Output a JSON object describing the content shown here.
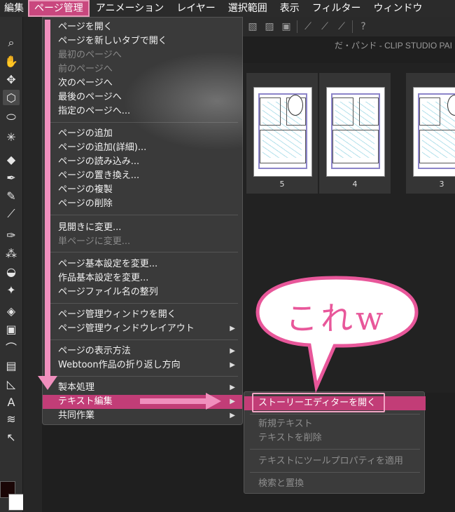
{
  "menubar": {
    "items": [
      "編集",
      "ページ管理",
      "アニメーション",
      "レイヤー",
      "選択範囲",
      "表示",
      "フィルター",
      "ウィンドウ"
    ],
    "active": "ページ管理",
    "accent": "#c9477e"
  },
  "window": {
    "title": "だ・パンド - CLIP STUDIO PAI"
  },
  "pages": [
    {
      "number": "5"
    },
    {
      "number": "4"
    },
    {
      "number": "3"
    }
  ],
  "menu": {
    "items": [
      {
        "label": "ページを開く",
        "enabled": true
      },
      {
        "label": "ページを新しいタブで開く",
        "enabled": true
      },
      {
        "label": "最初のページへ",
        "enabled": false
      },
      {
        "label": "前のページへ",
        "enabled": false
      },
      {
        "label": "次のページへ",
        "enabled": true
      },
      {
        "label": "最後のページへ",
        "enabled": true
      },
      {
        "label": "指定のページへ...",
        "enabled": true
      },
      {
        "label": "ページの追加",
        "enabled": true
      },
      {
        "label": "ページの追加(詳細)...",
        "enabled": true
      },
      {
        "label": "ページの読み込み...",
        "enabled": true
      },
      {
        "label": "ページの置き換え...",
        "enabled": true
      },
      {
        "label": "ページの複製",
        "enabled": true
      },
      {
        "label": "ページの削除",
        "enabled": true
      },
      {
        "label": "見開きに変更...",
        "enabled": true
      },
      {
        "label": "単ページに変更...",
        "enabled": false
      },
      {
        "label": "ページ基本設定を変更...",
        "enabled": true
      },
      {
        "label": "作品基本設定を変更...",
        "enabled": true
      },
      {
        "label": "ページファイル名の整列",
        "enabled": true
      },
      {
        "label": "ページ管理ウィンドウを開く",
        "enabled": true
      },
      {
        "label": "ページ管理ウィンドウレイアウト",
        "enabled": true,
        "submenu": true
      },
      {
        "label": "ページの表示方法",
        "enabled": true,
        "submenu": true
      },
      {
        "label": "Webtoon作品の折り返し方向",
        "enabled": true,
        "submenu": true
      },
      {
        "label": "製本処理",
        "enabled": true,
        "submenu": true
      },
      {
        "label": "テキスト編集",
        "enabled": true,
        "submenu": true,
        "highlighted": true
      },
      {
        "label": "共同作業",
        "enabled": true,
        "submenu": true
      }
    ]
  },
  "submenu": {
    "items": [
      {
        "label": "ストーリーエディターを開く",
        "enabled": true,
        "highlighted": true
      },
      {
        "label": "新規テキスト",
        "enabled": false
      },
      {
        "label": "テキストを削除",
        "enabled": false
      },
      {
        "label": "テキストにツールプロパティを適用",
        "enabled": false
      },
      {
        "label": "検索と置換",
        "enabled": false
      }
    ]
  },
  "annotation": {
    "callout_text": "これw",
    "color": "#f08fbd"
  },
  "icons": {
    "submenu_arrow": "▶"
  }
}
